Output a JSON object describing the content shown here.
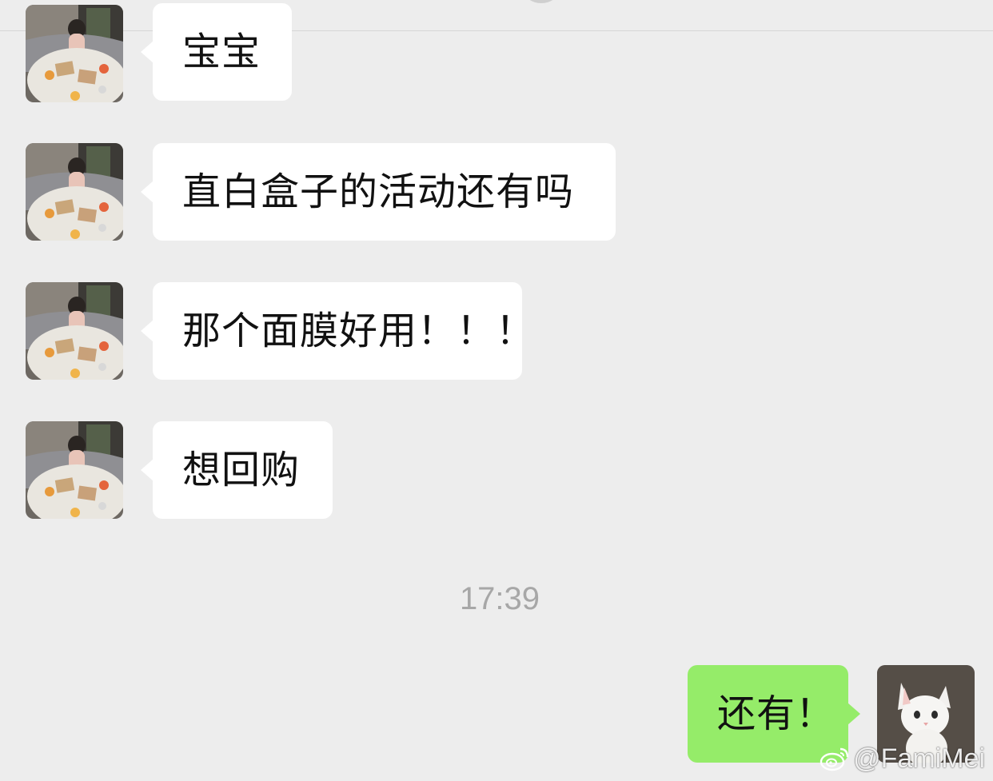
{
  "chat": {
    "messages": [
      {
        "sender": "other",
        "text": "宝宝"
      },
      {
        "sender": "other",
        "text": "直白盒子的活动还有吗"
      },
      {
        "sender": "other",
        "text": "那个面膜好用！！！"
      },
      {
        "sender": "other",
        "text": "想回购"
      },
      {
        "sender": "me",
        "text": "还有！"
      }
    ],
    "timestamp": "17:39"
  },
  "avatars": {
    "other": "photo-avatar-dining-table",
    "me": "photo-avatar-white-cat"
  },
  "watermark": {
    "handle": "@FamiMei",
    "icon": "weibo-icon"
  },
  "colors": {
    "background": "#ededed",
    "incoming_bubble": "#ffffff",
    "outgoing_bubble": "#95ec69",
    "timestamp_text": "#a7a7a7"
  }
}
